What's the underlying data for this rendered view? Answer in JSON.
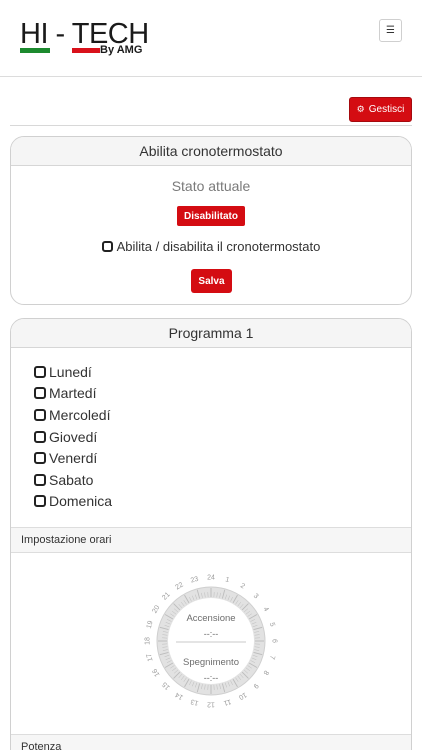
{
  "header": {
    "logo_main": "HI - TECH",
    "logo_sub": "By AMG",
    "menu_icon": "hamburger-icon"
  },
  "toolbar": {
    "manage_label": "Gestisci",
    "manage_icon": "gear-icon"
  },
  "thermostat": {
    "title": "Abilita cronotermostato",
    "status_label": "Stato attuale",
    "status_badge": "Disabilitato",
    "enable_checkbox_label": "Abilita / disabilita il cronotermostato",
    "enable_checked": false,
    "save_label": "Salva"
  },
  "program": {
    "title": "Programma 1",
    "days": [
      {
        "label": "Lunedí",
        "checked": false
      },
      {
        "label": "Martedí",
        "checked": false
      },
      {
        "label": "Mercoledí",
        "checked": false
      },
      {
        "label": "Giovedí",
        "checked": false
      },
      {
        "label": "Venerdí",
        "checked": false
      },
      {
        "label": "Sabato",
        "checked": false
      },
      {
        "label": "Domenica",
        "checked": false
      }
    ],
    "schedule_section": "Impostazione orari",
    "clock": {
      "hours": [
        "1",
        "2",
        "3",
        "4",
        "5",
        "6",
        "7",
        "8",
        "9",
        "10",
        "11",
        "12",
        "13",
        "14",
        "15",
        "16",
        "17",
        "18",
        "19",
        "20",
        "21",
        "22",
        "23",
        "24"
      ],
      "on_label": "Accensione",
      "on_value": "--:--",
      "off_label": "Spegnimento",
      "off_value": "--:--"
    },
    "power_section": "Potenza"
  },
  "colors": {
    "accent_red": "#d40c12",
    "logo_green": "#1c8a2f"
  }
}
